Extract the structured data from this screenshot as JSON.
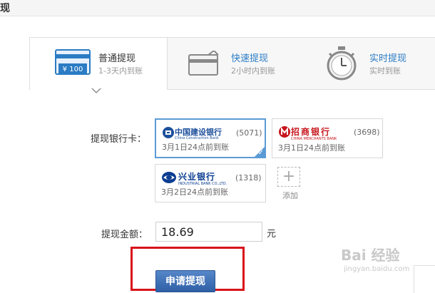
{
  "header": {
    "title": "现"
  },
  "tabs": [
    {
      "name": "普通提现",
      "desc": "1-3天内到账",
      "badge": "¥ 100",
      "icon": "card-money-icon",
      "active": true
    },
    {
      "name": "快速提现",
      "desc": "2小时内到账",
      "icon": "card-icon",
      "active": false
    },
    {
      "name": "实时提现",
      "desc": "实时到账",
      "icon": "stopwatch-icon",
      "active": false
    }
  ],
  "form": {
    "bank_label": "提现银行卡：",
    "amount_label": "提现金额：",
    "amount_value": "18.69",
    "unit": "元",
    "submit_label": "申请提现"
  },
  "cards": [
    {
      "bank": "中国建设银行",
      "bank_en": "China Construction Bank",
      "last4": "(5071)",
      "arrive": "3月1日24点前到账",
      "selected": true,
      "logo_color": "#1d4f9c"
    },
    {
      "bank": "招商银行",
      "bank_en": "CHINA MERCHANTS BANK",
      "last4": "(3698)",
      "arrive": "3月1日24点前到账",
      "selected": false,
      "logo_color": "#c8161d"
    },
    {
      "bank": "兴业银行",
      "bank_en": "INDUSTRIAL BANK CO.,LTD.",
      "last4": "(1318)",
      "arrive": "3月2日24点前到账",
      "selected": false,
      "logo_color": "#0b3d91"
    }
  ],
  "add_card": {
    "label": "添加"
  },
  "watermark": {
    "text": "Bai 经验",
    "url": "jingyan.baidu.com"
  },
  "colors": {
    "accent": "#2b7cc4",
    "selected_border": "#5b9bd5",
    "highlight": "#d8131b",
    "button": "#2f5fa6"
  }
}
